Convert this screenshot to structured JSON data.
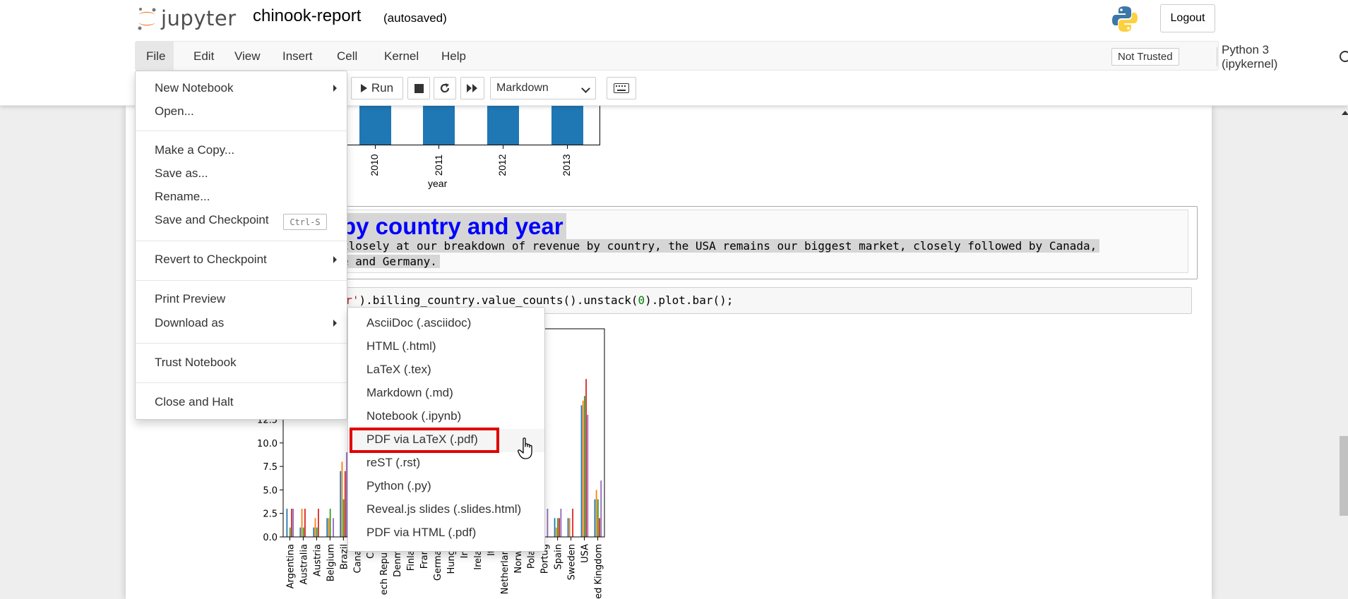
{
  "header": {
    "logo_text": "jupyter",
    "notebook_name": "chinook-report",
    "autosave": "(autosaved)",
    "logout_label": "Logout"
  },
  "menubar": {
    "items": [
      "File",
      "Edit",
      "View",
      "Insert",
      "Cell",
      "Kernel",
      "Help"
    ],
    "trust_label": "Not Trusted",
    "kernel_label": "Python 3 (ipykernel)"
  },
  "toolbar": {
    "run_label": "Run",
    "cell_type": "Markdown"
  },
  "top_chart": {
    "tick_labels": [
      "2010",
      "2011",
      "2012",
      "2013"
    ],
    "xlabel": "year"
  },
  "markdown_cell": {
    "heading": "by country and year",
    "line1": "closely at our breakdown of revenue by country, the USA remains our biggest market, closely followed by Canada,",
    "line2": "e and Germany."
  },
  "code_cell": {
    "pre": "",
    "str": "ear'",
    "mid": ").billing_country.value_counts().unstack(",
    "num": "0",
    "post": ").plot.bar();"
  },
  "chart_data": {
    "type": "bar",
    "yticks": [
      "0.0",
      "2.5",
      "5.0",
      "7.5",
      "10.0",
      "12.5"
    ],
    "ylim": [
      0,
      15
    ],
    "categories_visible": [
      "Argentina",
      "Australia",
      "Austria",
      "Belgium",
      "Brazil",
      "Canad",
      "Chi",
      "ech Republ",
      "Denma",
      "Finlan",
      "Franc",
      "German",
      "Hunga",
      "Ind",
      "Irelan",
      "Ita",
      "Netherlanc",
      "Norwa",
      "Polan",
      "Portug",
      "Spain",
      "Sweden",
      "USA",
      "ed Kingdom"
    ],
    "colors": [
      "#1f77b4",
      "#ff7f0e",
      "#2ca02c",
      "#d62728",
      "#9467bd"
    ]
  },
  "file_menu": {
    "items": [
      {
        "label": "New Notebook",
        "submenu": true
      },
      {
        "label": "Open..."
      },
      {
        "label": "Make a Copy..."
      },
      {
        "label": "Save as..."
      },
      {
        "label": "Rename..."
      },
      {
        "label": "Save and Checkpoint",
        "shortcut": "Ctrl-S"
      },
      {
        "label": "Revert to Checkpoint",
        "submenu": true
      },
      {
        "label": "Print Preview"
      },
      {
        "label": "Download as",
        "submenu": true
      },
      {
        "label": "Trust Notebook"
      },
      {
        "label": "Close and Halt"
      }
    ]
  },
  "download_menu": {
    "items": [
      "AsciiDoc (.asciidoc)",
      "HTML (.html)",
      "LaTeX (.tex)",
      "Markdown (.md)",
      "Notebook (.ipynb)",
      "PDF via LaTeX (.pdf)",
      "reST (.rst)",
      "Python (.py)",
      "Reveal.js slides (.slides.html)",
      "PDF via HTML (.pdf)"
    ],
    "highlighted": "PDF via LaTeX (.pdf)"
  }
}
